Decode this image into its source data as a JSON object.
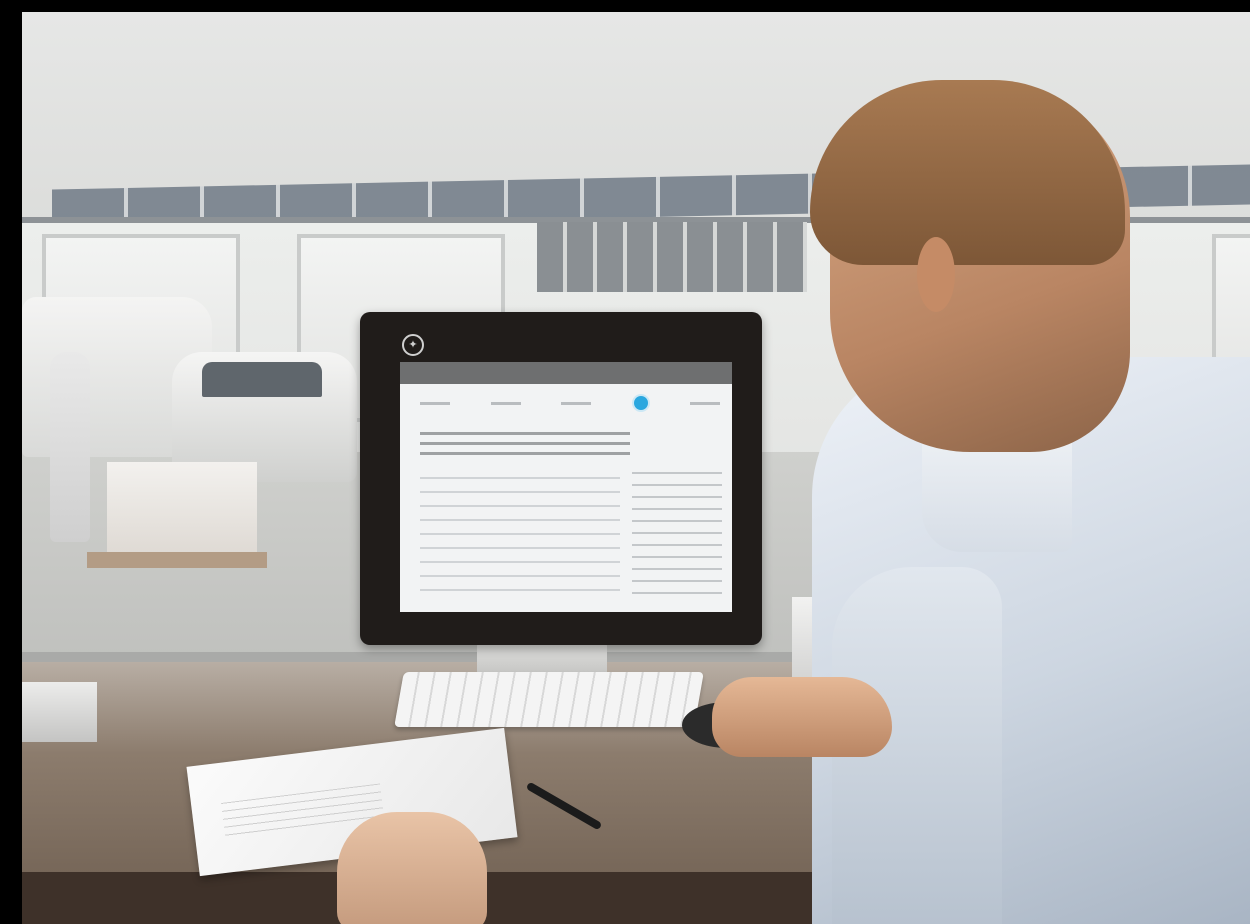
{
  "scene": {
    "description_items": [
      "building",
      "van",
      "car",
      "worker",
      "pallet",
      "monitor",
      "keyboard",
      "mouse",
      "paper",
      "pen",
      "man"
    ]
  },
  "monitor": {
    "logo_icon": "brand-star-icon",
    "screen": {
      "accent_color": "#2aa7df"
    }
  }
}
